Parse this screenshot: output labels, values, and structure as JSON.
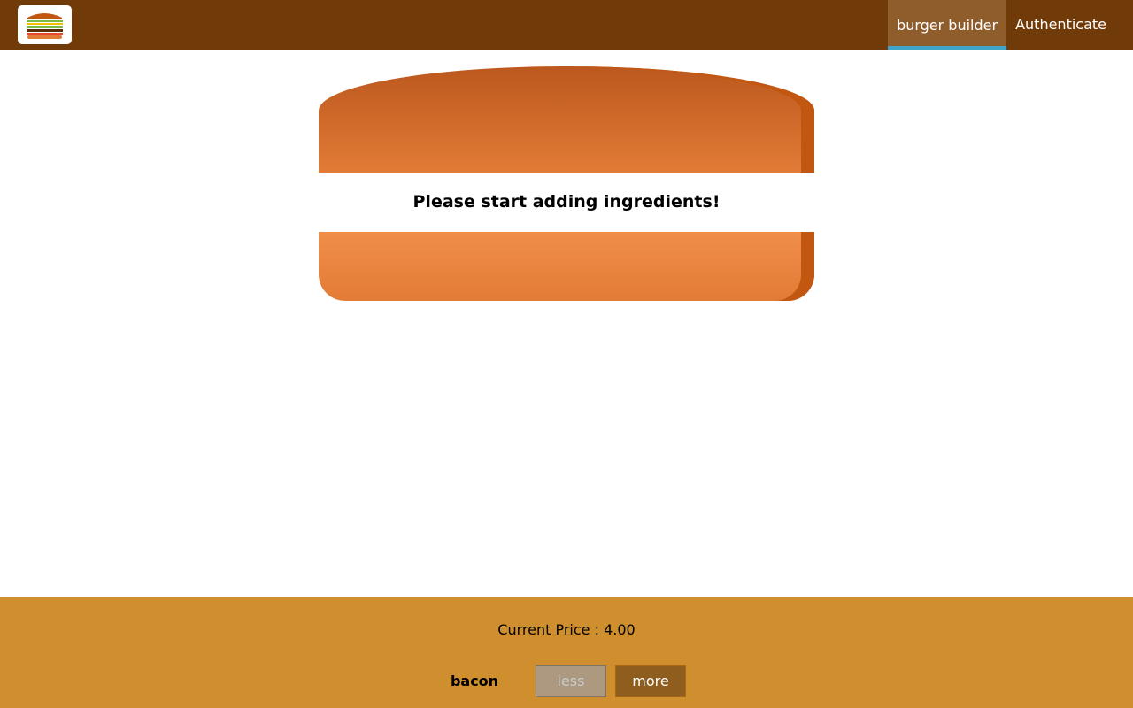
{
  "toolbar": {
    "logo_icon": "burger-logo-icon",
    "nav": [
      {
        "label": "burger builder",
        "active": true
      },
      {
        "label": "Authenticate",
        "active": false
      }
    ]
  },
  "burger": {
    "message": "Please start adding ingredients!"
  },
  "controls": {
    "price_label": "Current Price : 4.00",
    "ingredients": [
      {
        "label": "bacon",
        "less_label": "less",
        "more_label": "more",
        "less_disabled": true
      }
    ]
  },
  "colors": {
    "toolbar": "#703b09",
    "nav_active_bg": "#8f5c2c",
    "nav_active_border": "#40a4c8",
    "controls_bg": "#cf8f2e",
    "more_btn": "#8f5e1e",
    "less_btn_disabled": "#ac9980"
  }
}
